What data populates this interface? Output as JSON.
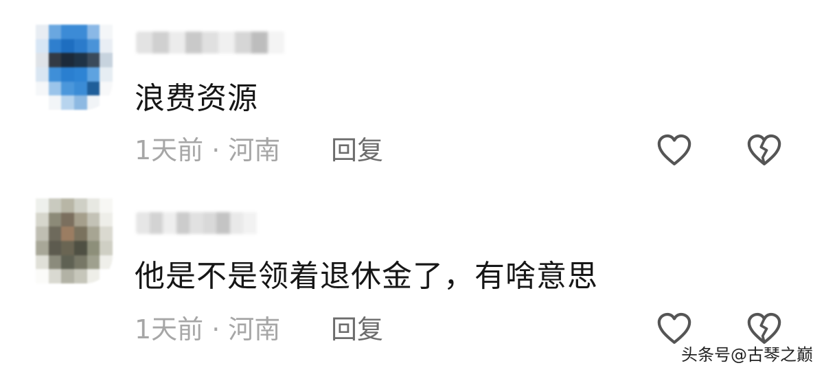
{
  "comments": [
    {
      "text": "浪费资源",
      "time": "1天前",
      "separator": "·",
      "location": "河南",
      "reply_label": "回复",
      "like_icon": "heart-outline-icon",
      "dislike_icon": "broken-heart-icon",
      "avatar_colors": [
        "#e8edf3",
        "#6aa7e0",
        "#3c8bd6",
        "#3c8bd6",
        "#8ab8e6",
        "#f4f6f8",
        "#d7e6f5",
        "#2f7fce",
        "#1e6ec0",
        "#2b7bcb",
        "#4a93d8",
        "#e9eef4",
        "#dfe3e8",
        "#333a44",
        "#1c2a3a",
        "#1f3346",
        "#3a4a5a",
        "#c7d3de",
        "#d9e6f2",
        "#3f8fd8",
        "#2a7fd0",
        "#2e84d4",
        "#5ea3e0",
        "#e6edf3",
        "#f5f7f9",
        "#9ac4ea",
        "#4b97db",
        "#3b8cd6",
        "#1f5e99",
        "#f7f8f9",
        "#ffffff",
        "#f2f5f8",
        "#b7d4ee",
        "#8db9e2",
        "#f1f4f7",
        "#ffffff"
      ],
      "username_colors": [
        "#e3e3e3",
        "#d0d0d0",
        "#ececec",
        "#c9c9c9",
        "#e0e0e0",
        "#f0f0f0",
        "#d6d6d6",
        "#bdbdbd",
        "#f4f4f4",
        "#ffffff"
      ]
    },
    {
      "text": "他是不是领着退休金了，有啥意思",
      "time": "1天前",
      "separator": "·",
      "location": "河南",
      "reply_label": "回复",
      "like_icon": "heart-outline-icon",
      "dislike_icon": "broken-heart-icon",
      "avatar_colors": [
        "#eef0ec",
        "#c9cabf",
        "#b8b6a6",
        "#cfd0c6",
        "#e7e8e2",
        "#f7f7f4",
        "#d6d6cc",
        "#8c8a78",
        "#7b6f5e",
        "#a59f8c",
        "#c3c2b6",
        "#eeeee9",
        "#bfbeb2",
        "#6e6a5c",
        "#9b7d62",
        "#7a725e",
        "#a7a593",
        "#dad9d0",
        "#a8a798",
        "#5d5b4f",
        "#6a6553",
        "#4f5043",
        "#8d8f7a",
        "#cfcfc4",
        "#e0e0d8",
        "#8b8b7c",
        "#5f6153",
        "#777766",
        "#9fa08e",
        "#efefea",
        "#fbfbf9",
        "#d9d9d1",
        "#b2b2a5",
        "#c6c6ba",
        "#eeeee8",
        "#ffffff"
      ],
      "username_colors": [
        "#e6e6e6",
        "#d3d3d3",
        "#eeeeee",
        "#cccccc",
        "#e1e1e1",
        "#d9d9d9",
        "#c4c4c4",
        "#e9e9e9",
        "#f2f2f2",
        "#ffffff"
      ]
    }
  ],
  "watermark": "头条号@古琴之巅"
}
